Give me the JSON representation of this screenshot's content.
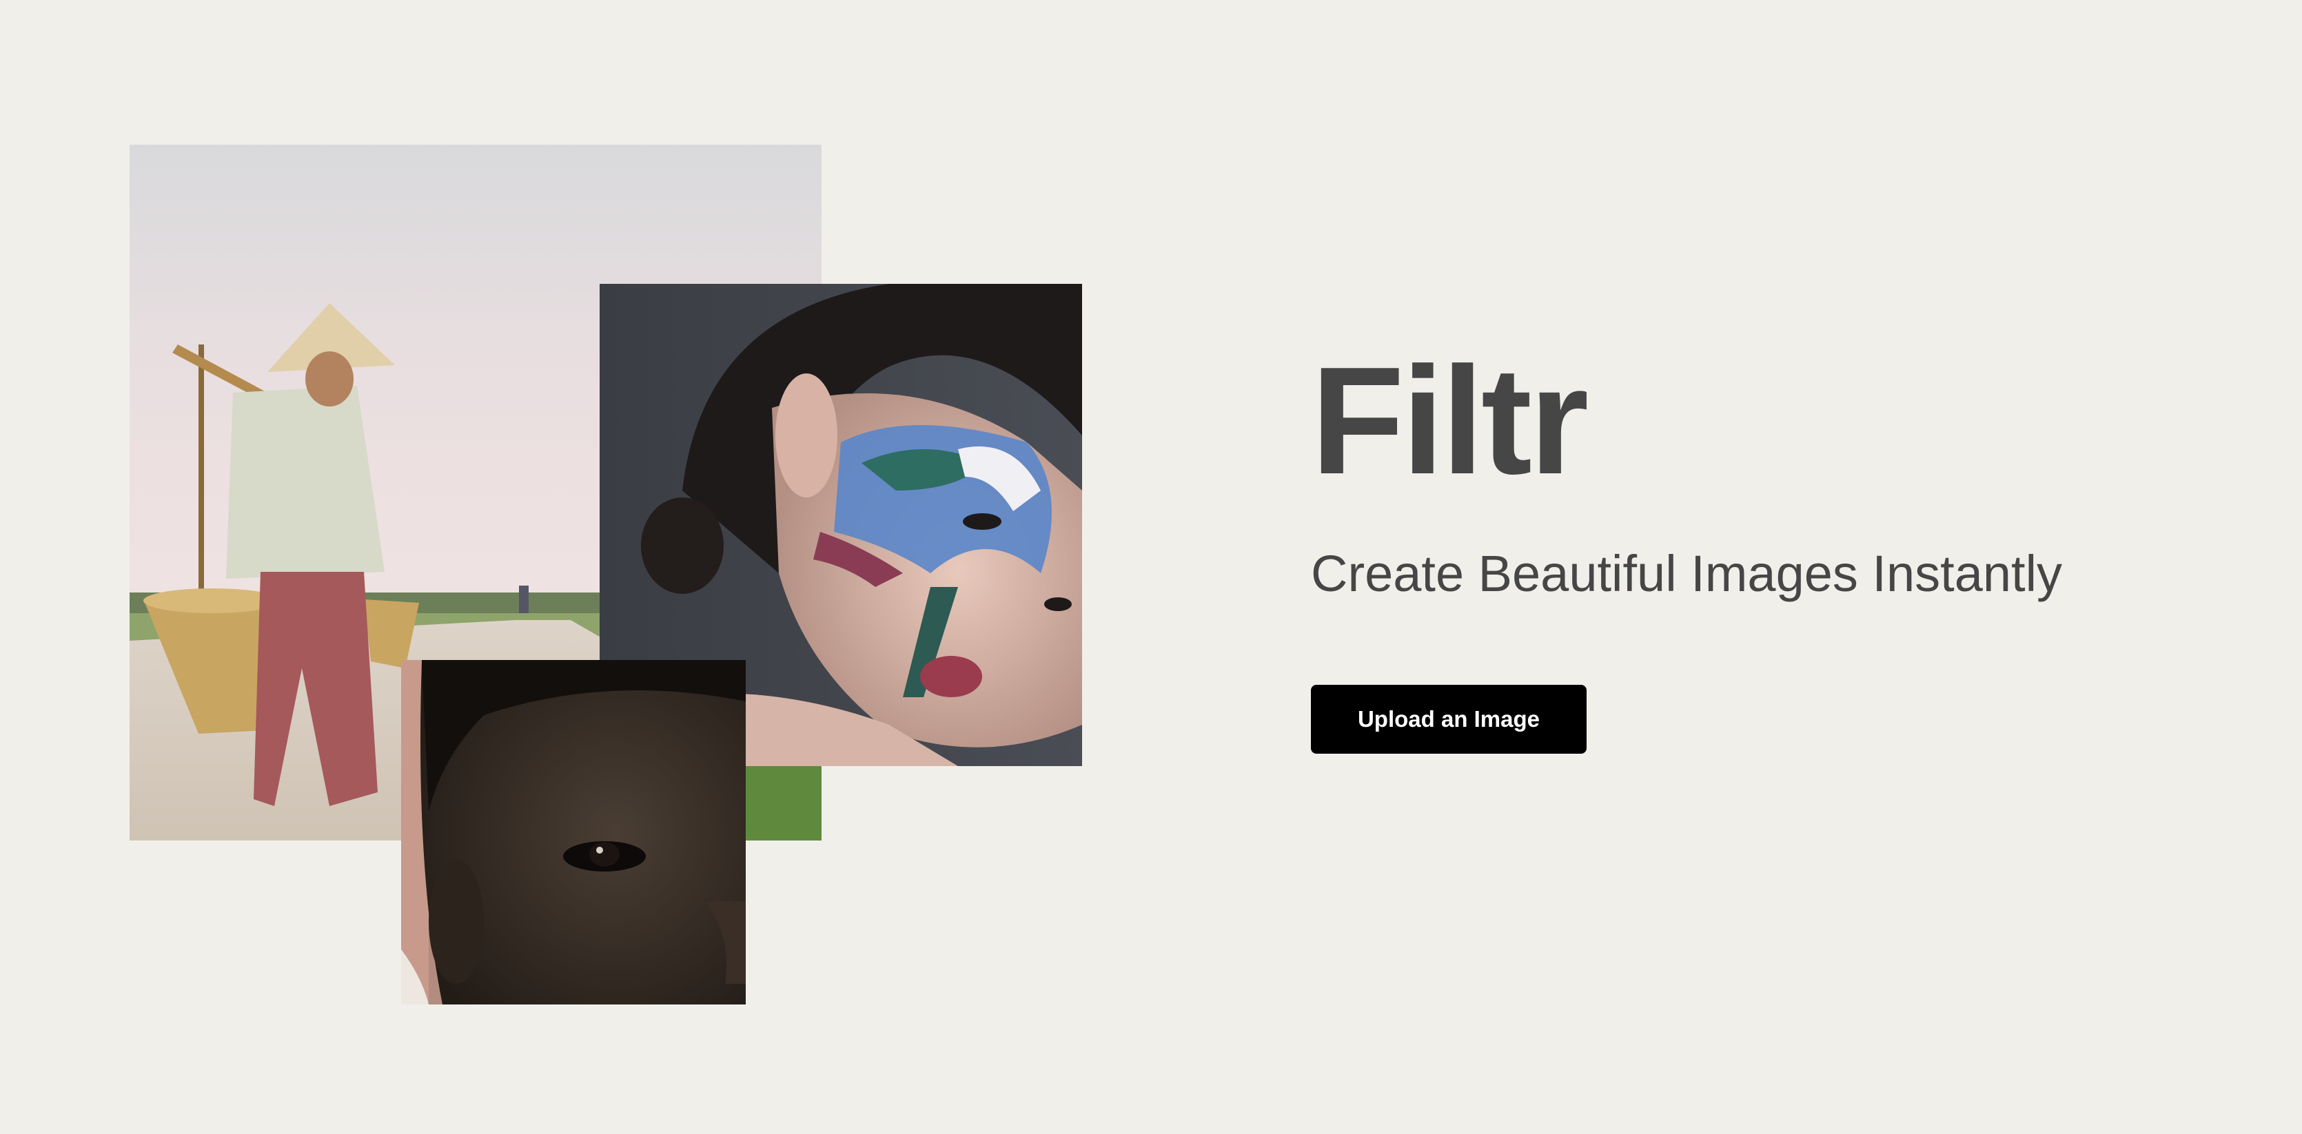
{
  "hero": {
    "title": "Filtr",
    "tagline": "Create Beautiful Images Instantly",
    "upload_label": "Upload an Image"
  },
  "colors": {
    "background": "#f1efea",
    "text": "#464646",
    "button_bg": "#000000",
    "button_text": "#ffffff"
  },
  "collage": [
    {
      "name": "woman-with-conical-hat-carrying-baskets"
    },
    {
      "name": "woman-with-painted-face"
    },
    {
      "name": "close-up-face-portrait"
    }
  ]
}
